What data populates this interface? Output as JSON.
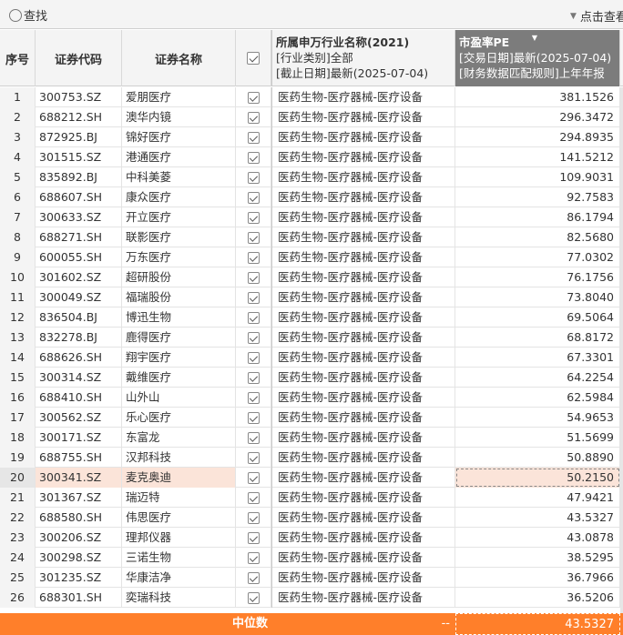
{
  "toolbar": {
    "search_label": "查找",
    "right_label": "点击查看"
  },
  "header": {
    "index": "序号",
    "code": "证券代码",
    "name": "证券名称",
    "industry": {
      "title": "所属申万行业名称(2021)",
      "line2": "[行业类别]全部",
      "line3": "[截止日期]最新(2025-07-04)"
    },
    "pe": {
      "title": "市盈率PE",
      "line2": "[交易日期]最新(2025-07-04)",
      "line3": "[财务数据匹配规则]上年年报"
    }
  },
  "rows": [
    {
      "idx": "1",
      "code": "300753.SZ",
      "name": "爱朋医疗",
      "industry": "医药生物-医疗器械-医疗设备",
      "pe": "381.1526"
    },
    {
      "idx": "2",
      "code": "688212.SH",
      "name": "澳华内镜",
      "industry": "医药生物-医疗器械-医疗设备",
      "pe": "296.3472"
    },
    {
      "idx": "3",
      "code": "872925.BJ",
      "name": "锦好医疗",
      "industry": "医药生物-医疗器械-医疗设备",
      "pe": "294.8935"
    },
    {
      "idx": "4",
      "code": "301515.SZ",
      "name": "港通医疗",
      "industry": "医药生物-医疗器械-医疗设备",
      "pe": "141.5212"
    },
    {
      "idx": "5",
      "code": "835892.BJ",
      "name": "中科美菱",
      "industry": "医药生物-医疗器械-医疗设备",
      "pe": "109.9031"
    },
    {
      "idx": "6",
      "code": "688607.SH",
      "name": "康众医疗",
      "industry": "医药生物-医疗器械-医疗设备",
      "pe": "92.7583"
    },
    {
      "idx": "7",
      "code": "300633.SZ",
      "name": "开立医疗",
      "industry": "医药生物-医疗器械-医疗设备",
      "pe": "86.1794"
    },
    {
      "idx": "8",
      "code": "688271.SH",
      "name": "联影医疗",
      "industry": "医药生物-医疗器械-医疗设备",
      "pe": "82.5680"
    },
    {
      "idx": "9",
      "code": "600055.SH",
      "name": "万东医疗",
      "industry": "医药生物-医疗器械-医疗设备",
      "pe": "77.0302"
    },
    {
      "idx": "10",
      "code": "301602.SZ",
      "name": "超研股份",
      "industry": "医药生物-医疗器械-医疗设备",
      "pe": "76.1756"
    },
    {
      "idx": "11",
      "code": "300049.SZ",
      "name": "福瑞股份",
      "industry": "医药生物-医疗器械-医疗设备",
      "pe": "73.8040"
    },
    {
      "idx": "12",
      "code": "836504.BJ",
      "name": "博迅生物",
      "industry": "医药生物-医疗器械-医疗设备",
      "pe": "69.5064"
    },
    {
      "idx": "13",
      "code": "832278.BJ",
      "name": "鹿得医疗",
      "industry": "医药生物-医疗器械-医疗设备",
      "pe": "68.8172"
    },
    {
      "idx": "14",
      "code": "688626.SH",
      "name": "翔宇医疗",
      "industry": "医药生物-医疗器械-医疗设备",
      "pe": "67.3301"
    },
    {
      "idx": "15",
      "code": "300314.SZ",
      "name": "戴维医疗",
      "industry": "医药生物-医疗器械-医疗设备",
      "pe": "64.2254"
    },
    {
      "idx": "16",
      "code": "688410.SH",
      "name": "山外山",
      "industry": "医药生物-医疗器械-医疗设备",
      "pe": "62.5984"
    },
    {
      "idx": "17",
      "code": "300562.SZ",
      "name": "乐心医疗",
      "industry": "医药生物-医疗器械-医疗设备",
      "pe": "54.9653"
    },
    {
      "idx": "18",
      "code": "300171.SZ",
      "name": "东富龙",
      "industry": "医药生物-医疗器械-医疗设备",
      "pe": "51.5699"
    },
    {
      "idx": "19",
      "code": "688755.SH",
      "name": "汉邦科技",
      "industry": "医药生物-医疗器械-医疗设备",
      "pe": "50.8890"
    },
    {
      "idx": "20",
      "code": "300341.SZ",
      "name": "麦克奥迪",
      "industry": "医药生物-医疗器械-医疗设备",
      "pe": "50.2150"
    },
    {
      "idx": "21",
      "code": "301367.SZ",
      "name": "瑞迈特",
      "industry": "医药生物-医疗器械-医疗设备",
      "pe": "47.9421"
    },
    {
      "idx": "22",
      "code": "688580.SH",
      "name": "伟思医疗",
      "industry": "医药生物-医疗器械-医疗设备",
      "pe": "43.5327"
    },
    {
      "idx": "23",
      "code": "300206.SZ",
      "name": "理邦仪器",
      "industry": "医药生物-医疗器械-医疗设备",
      "pe": "43.0878"
    },
    {
      "idx": "24",
      "code": "300298.SZ",
      "name": "三诺生物",
      "industry": "医药生物-医疗器械-医疗设备",
      "pe": "38.5295"
    },
    {
      "idx": "25",
      "code": "301235.SZ",
      "name": "华康洁净",
      "industry": "医药生物-医疗器械-医疗设备",
      "pe": "36.7966"
    },
    {
      "idx": "26",
      "code": "688301.SH",
      "name": "奕瑞科技",
      "industry": "医药生物-医疗器械-医疗设备",
      "pe": "36.5206"
    }
  ],
  "highlight_row_index": 19,
  "footer": {
    "label": "中位数",
    "industry_value": "--",
    "pe_value": "43.5327"
  },
  "colors": {
    "footer_bg": "#ff7f2a",
    "highlight_bg": "#fbe4d9",
    "pe_header_bg": "#7c7c7c"
  },
  "icons": {
    "search": "search-icon",
    "dropdown": "dropdown-triangle-icon",
    "checkbox": "checkbox-checked-icon"
  }
}
